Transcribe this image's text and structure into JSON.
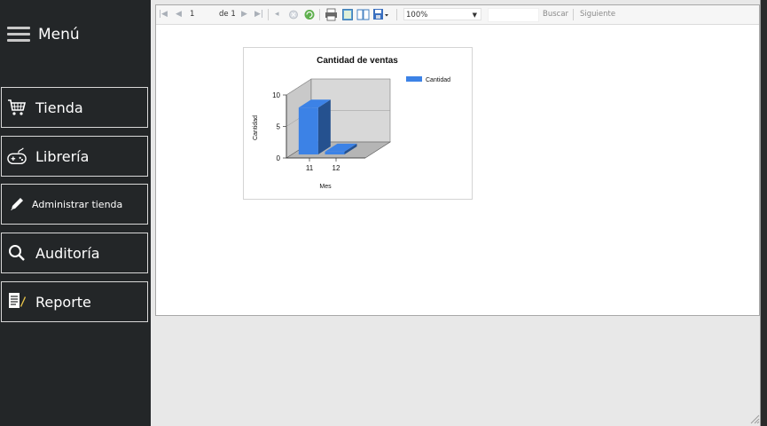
{
  "sidebar": {
    "menu_title": "Menú",
    "items": [
      {
        "label": "Tienda",
        "icon": "cart-icon"
      },
      {
        "label": "Librería",
        "icon": "gamepad-icon"
      },
      {
        "label": "Administrar tienda",
        "icon": "pencil-icon"
      },
      {
        "label": "Auditoría",
        "icon": "search-icon"
      },
      {
        "label": "Reporte",
        "icon": "report-icon"
      }
    ]
  },
  "toolbar": {
    "page_current": "1",
    "page_of": "de 1",
    "zoom": "100%",
    "find_label": "Buscar",
    "next_label": "Siguiente"
  },
  "chart_data": {
    "type": "bar",
    "title": "Cantidad de ventas",
    "xlabel": "Mes",
    "ylabel": "Cantidad",
    "categories": [
      "11",
      "12"
    ],
    "series": [
      {
        "name": "Cantidad",
        "values": [
          8,
          1
        ]
      }
    ],
    "ylim": [
      0,
      10
    ],
    "yticks": [
      "0",
      "5",
      "10"
    ],
    "legend_position": "top-right",
    "three_d": true,
    "bar_color": "#3c82e6"
  }
}
